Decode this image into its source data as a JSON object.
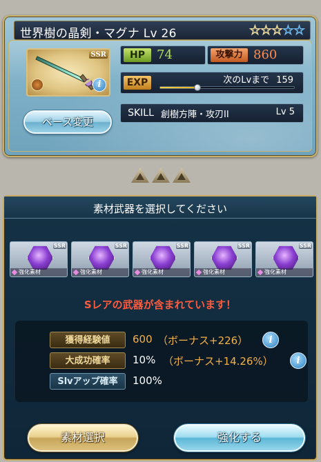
{
  "weapon": {
    "title": "世界樹の晶剣・マグナ Lv 26",
    "rarity_badge": "SSR",
    "stars_gold": "☆☆☆",
    "stars_blue": "☆☆",
    "base_change_label": "ベース変更",
    "stats": {
      "hp_label": "HP",
      "hp_value": "74",
      "atk_label": "攻撃力",
      "atk_value": "860",
      "exp_label": "EXP",
      "exp_next_label": "次のLvまで",
      "exp_next_value": "159",
      "exp_progress": 0.28,
      "skill_label": "SKILL",
      "skill_name": "創樹方陣・攻刃II",
      "skill_level": "Lv 5"
    }
  },
  "panel": {
    "title": "素材武器を選択してください",
    "materials": [
      {
        "label": "強化素材",
        "badge": "SSR"
      },
      {
        "label": "強化素材",
        "badge": "SSR"
      },
      {
        "label": "強化素材",
        "badge": "SSR"
      },
      {
        "label": "強化素材",
        "badge": "SSR"
      },
      {
        "label": "強化素材",
        "badge": "SSR"
      }
    ],
    "warning": "Sレアの武器が含まれています！",
    "info": {
      "exp_label": "獲得経験値",
      "exp_value": "600",
      "exp_bonus": "（ボーナス+226）",
      "success_label": "大成功確率",
      "success_value": "10%",
      "success_bonus": "（ボーナス+14.26%）",
      "slv_label": "Slvアップ確率",
      "slv_value": "100%"
    },
    "buttons": {
      "material_select": "素材選択",
      "enhance": "強化する"
    }
  },
  "icons": {
    "info": "i",
    "colors": {
      "warning": "#ff5a3d",
      "hp": "#b9e65a",
      "atk": "#ff8a4a",
      "bonus": "#f5b14a"
    }
  }
}
